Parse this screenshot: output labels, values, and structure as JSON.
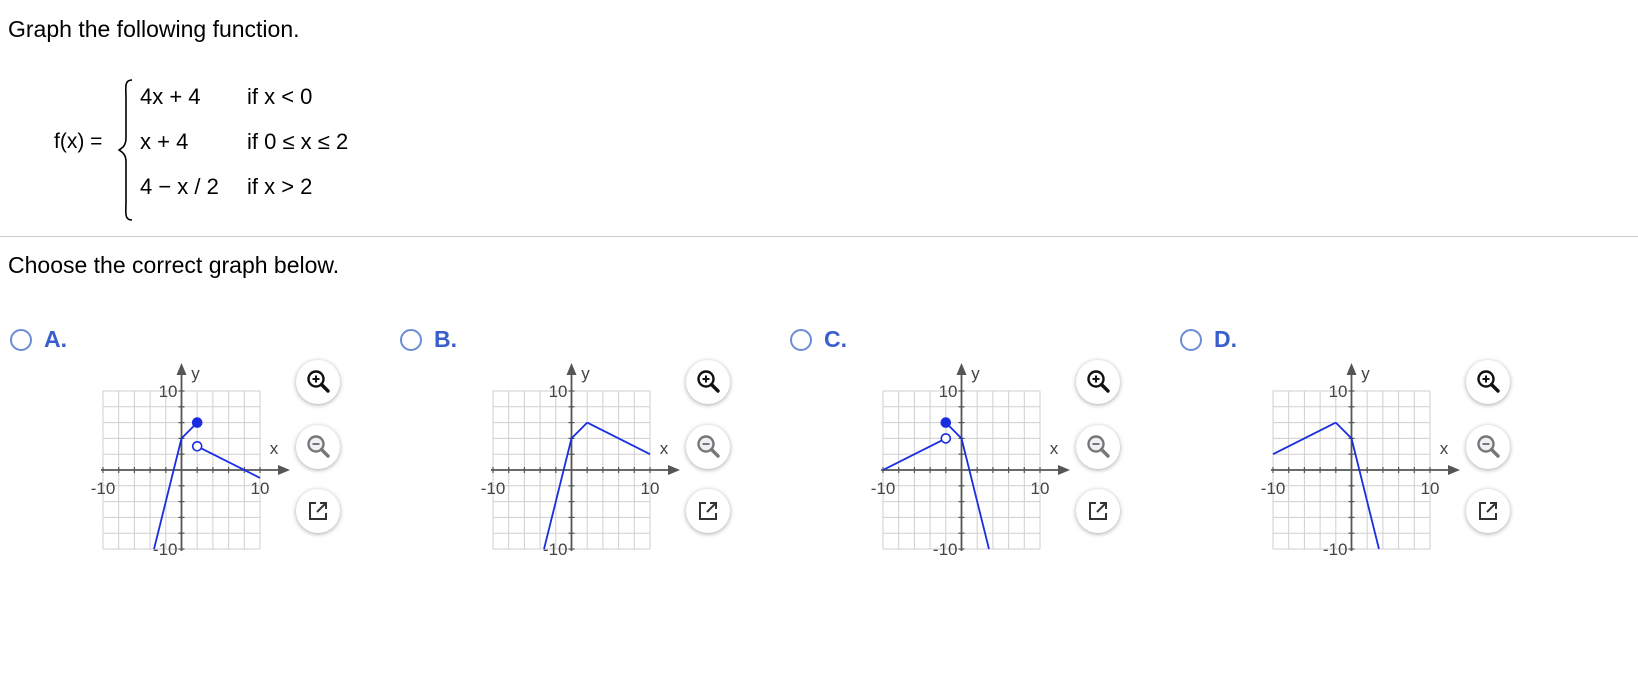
{
  "question": {
    "prompt": "Graph the following function.",
    "function_label": "f(x) =",
    "cases": [
      {
        "expr": "4x + 4",
        "cond": "if x < 0"
      },
      {
        "expr": "x + 4",
        "cond": "if 0 ≤ x ≤ 2"
      },
      {
        "expr": "4 − x / 2",
        "cond": "if x > 2"
      }
    ],
    "instruction": "Choose the correct graph below."
  },
  "graph_labels": {
    "x_axis": "x",
    "y_axis": "y",
    "tick_min": "-10",
    "tick_max": "10"
  },
  "colors": {
    "curve": "#1a2de0",
    "grid": "#cfcfcf",
    "axis": "#555555",
    "option_letter": "#3a5fcd",
    "radio_border": "#6b8dd6"
  },
  "tool_icons": [
    "zoom-in-icon",
    "zoom-out-icon",
    "popout-icon"
  ],
  "options": [
    {
      "letter": "A.",
      "chart_data": {
        "type": "line",
        "xlim": [
          -10,
          10
        ],
        "ylim": [
          -10,
          10
        ],
        "xlabel": "x",
        "ylabel": "y",
        "grid": true,
        "series": [
          {
            "x": [
              -3.5,
              0
            ],
            "y": [
              -10,
              4
            ]
          },
          {
            "x": [
              0,
              2
            ],
            "y": [
              4,
              6
            ]
          },
          {
            "x": [
              2,
              10
            ],
            "y": [
              3,
              -1
            ]
          }
        ],
        "points": [
          {
            "x": 2,
            "y": 6,
            "filled": true
          },
          {
            "x": 2,
            "y": 3,
            "filled": false
          }
        ]
      }
    },
    {
      "letter": "B.",
      "chart_data": {
        "type": "line",
        "xlim": [
          -10,
          10
        ],
        "ylim": [
          -10,
          10
        ],
        "xlabel": "x",
        "ylabel": "y",
        "grid": true,
        "series": [
          {
            "x": [
              -3.5,
              0
            ],
            "y": [
              -10,
              4
            ]
          },
          {
            "x": [
              0,
              2
            ],
            "y": [
              4,
              6
            ]
          },
          {
            "x": [
              2,
              10
            ],
            "y": [
              6,
              2
            ]
          }
        ],
        "points": []
      }
    },
    {
      "letter": "C.",
      "chart_data": {
        "type": "line",
        "xlim": [
          -10,
          10
        ],
        "ylim": [
          -10,
          10
        ],
        "xlabel": "x",
        "ylabel": "y",
        "grid": true,
        "series": [
          {
            "x": [
              -10,
              -2
            ],
            "y": [
              0,
              4
            ]
          },
          {
            "x": [
              -2,
              0
            ],
            "y": [
              6,
              4
            ]
          },
          {
            "x": [
              0,
              3.5
            ],
            "y": [
              4,
              -10
            ]
          }
        ],
        "points": [
          {
            "x": -2,
            "y": 6,
            "filled": true
          },
          {
            "x": -2,
            "y": 4,
            "filled": false
          }
        ]
      }
    },
    {
      "letter": "D.",
      "chart_data": {
        "type": "line",
        "xlim": [
          -10,
          10
        ],
        "ylim": [
          -10,
          10
        ],
        "xlabel": "x",
        "ylabel": "y",
        "grid": true,
        "series": [
          {
            "x": [
              -10,
              -2
            ],
            "y": [
              2,
              6
            ]
          },
          {
            "x": [
              -2,
              0
            ],
            "y": [
              6,
              4
            ]
          },
          {
            "x": [
              0,
              3.5
            ],
            "y": [
              4,
              -10
            ]
          }
        ],
        "points": []
      }
    }
  ]
}
